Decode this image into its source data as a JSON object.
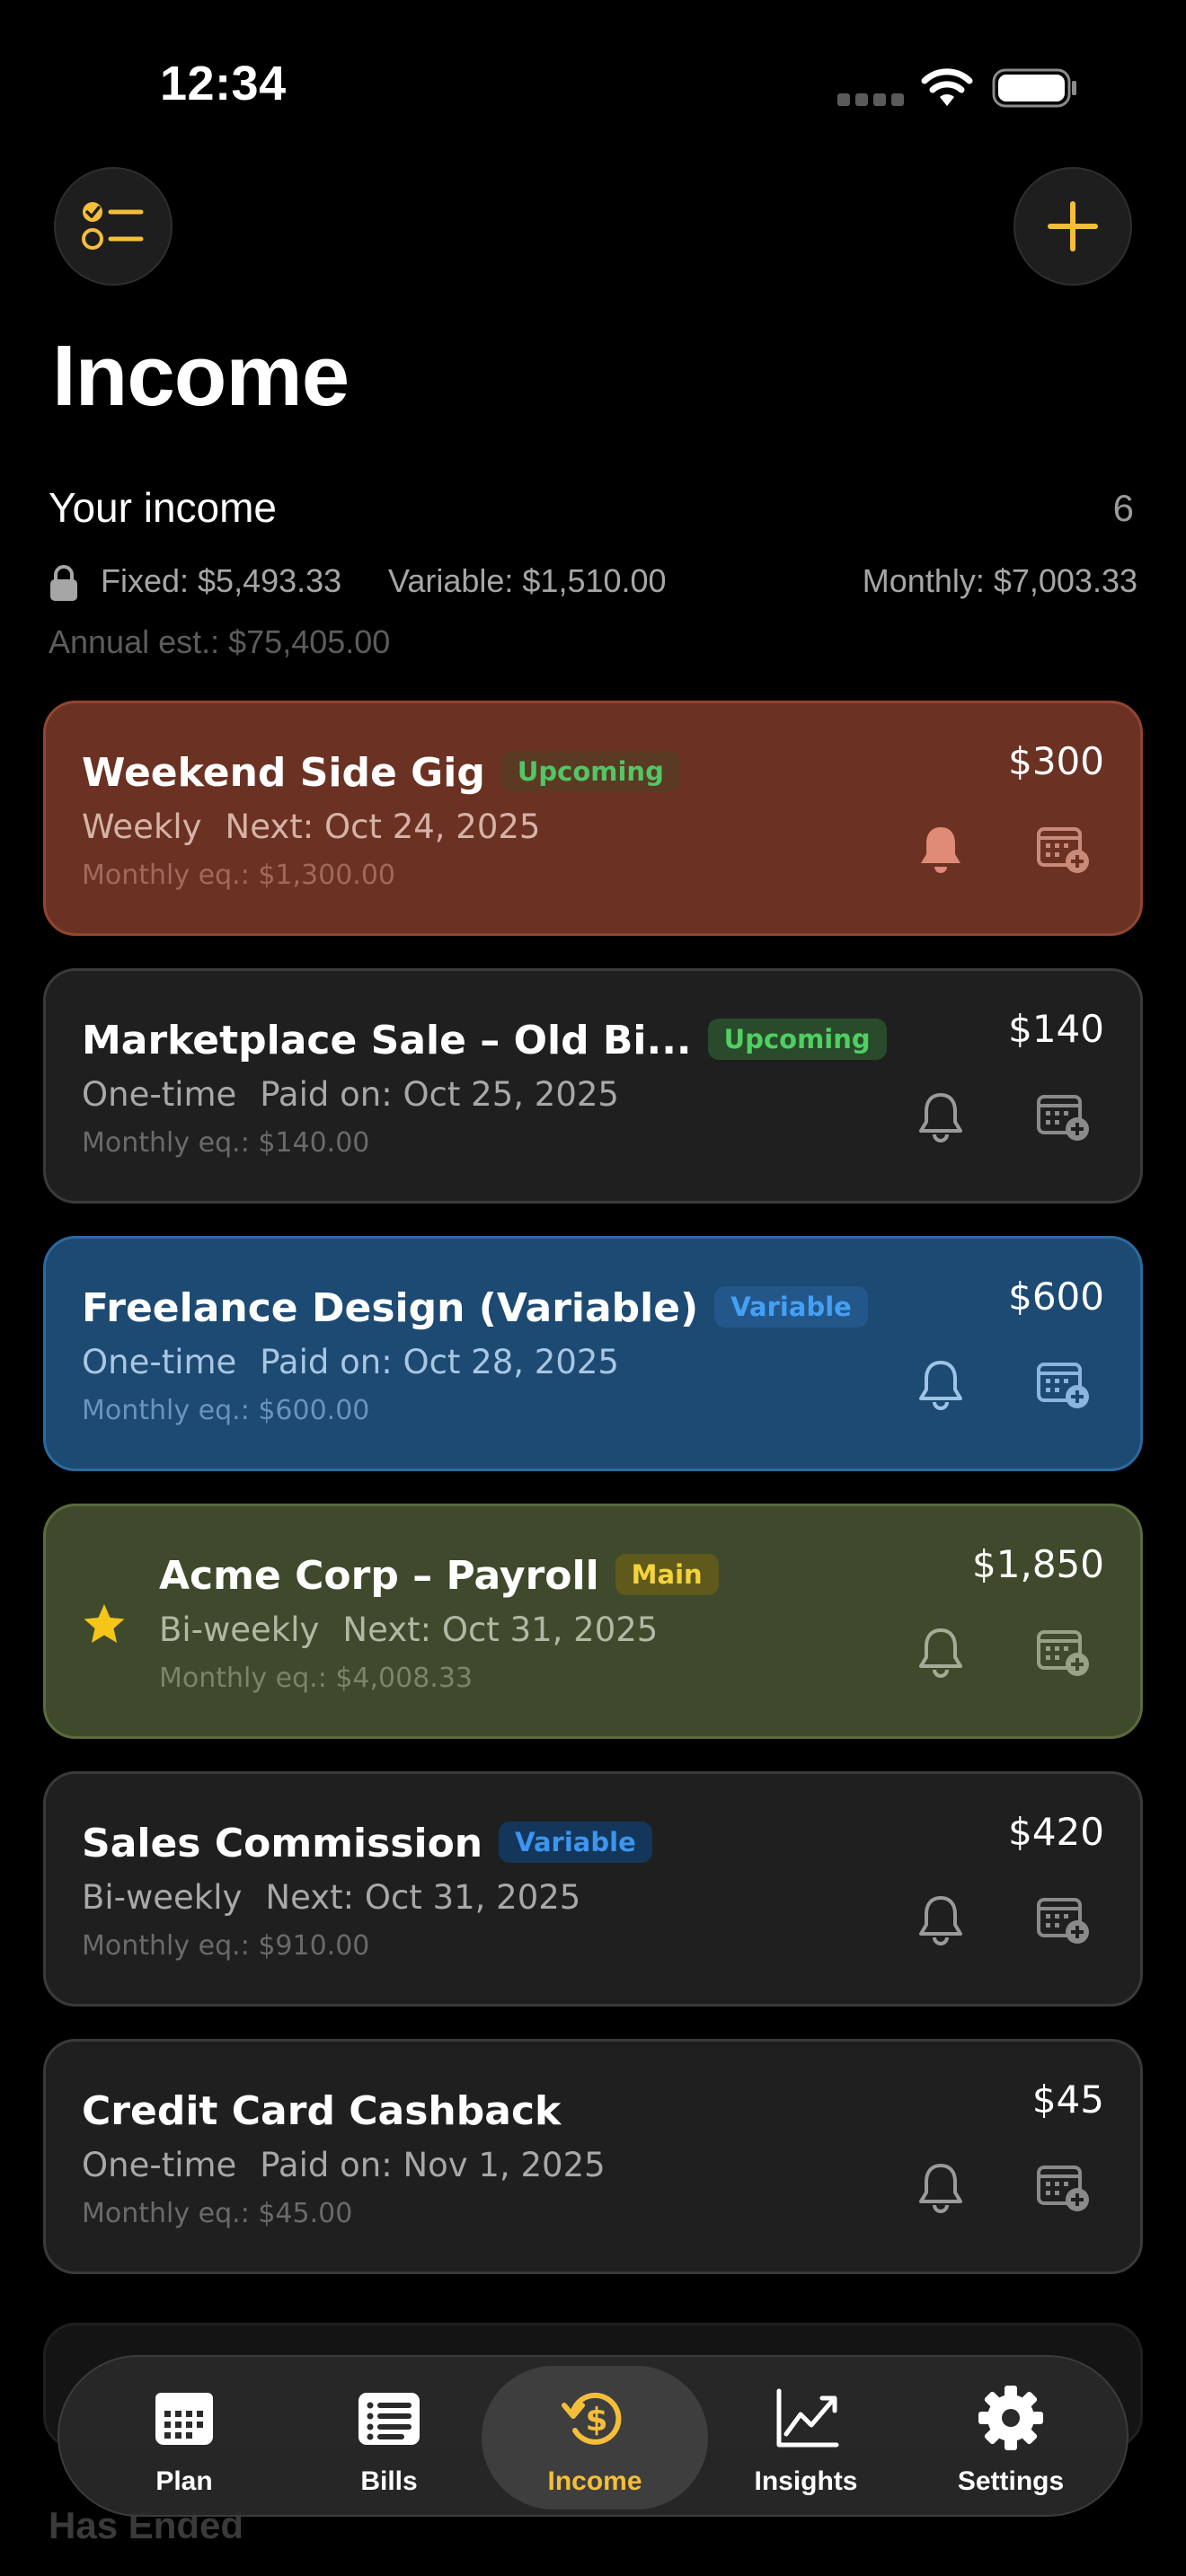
{
  "status_bar": {
    "time": "12:34"
  },
  "header": {
    "title": "Income",
    "left_icon": "checklist-icon",
    "right_icon": "plus-icon"
  },
  "summary": {
    "title": "Your income",
    "count": "6",
    "fixed": "Fixed: $5,493.33",
    "variable": "Variable: $1,510.00",
    "monthly": "Monthly: $7,003.33",
    "annual": "Annual est.: $75,405.00"
  },
  "cards": [
    {
      "name": "Weekend Side Gig",
      "badge": "Upcoming",
      "frequency": "Weekly",
      "date": "Next: Oct 24, 2025",
      "monthly_eq": "Monthly eq.: $1,300.00",
      "amount": "$300",
      "color": "#6b3224"
    },
    {
      "name": "Marketplace Sale – Old Bi...",
      "badge": "Upcoming",
      "frequency": "One-time",
      "date": "Paid on: Oct 25, 2025",
      "monthly_eq": "Monthly eq.: $140.00",
      "amount": "$140",
      "color": "#1f1f1f"
    },
    {
      "name": "Freelance Design (Variable)",
      "badge": "Variable",
      "frequency": "One-time",
      "date": "Paid on: Oct 28, 2025",
      "monthly_eq": "Monthly eq.: $600.00",
      "amount": "$600",
      "color": "#1c4a72"
    },
    {
      "name": "Acme Corp – Payroll",
      "badge": "Main",
      "frequency": "Bi-weekly",
      "date": "Next: Oct 31, 2025",
      "monthly_eq": "Monthly eq.: $4,008.33",
      "amount": "$1,850",
      "color": "#3f4a2c",
      "starred": true
    },
    {
      "name": "Sales Commission",
      "badge": "Variable",
      "frequency": "Bi-weekly",
      "date": "Next: Oct 31, 2025",
      "monthly_eq": "Monthly eq.: $910.00",
      "amount": "$420",
      "color": "#1f1f1f"
    },
    {
      "name": "Credit Card Cashback",
      "frequency": "One-time",
      "date": "Paid on: Nov 1, 2025",
      "monthly_eq": "Monthly eq.: $45.00",
      "amount": "$45",
      "color": "#1f1f1f"
    }
  ],
  "section": {
    "ended_label": "Has Ended"
  },
  "tabs": [
    {
      "label": "Plan",
      "icon": "calendar-grid-icon"
    },
    {
      "label": "Bills",
      "icon": "list-icon"
    },
    {
      "label": "Income",
      "icon": "dollar-cycle-icon",
      "active": true
    },
    {
      "label": "Insights",
      "icon": "trend-chart-icon"
    },
    {
      "label": "Settings",
      "icon": "gear-icon"
    }
  ],
  "colors": {
    "accent": "#f4be3a",
    "upcoming": "#4fd061",
    "variable": "#3c95ee",
    "main": "#f5d33a"
  }
}
